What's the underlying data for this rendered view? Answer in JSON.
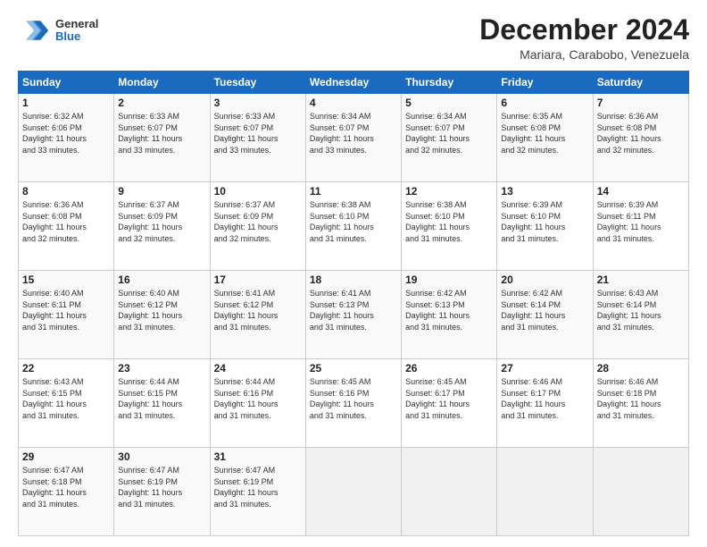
{
  "header": {
    "logo_general": "General",
    "logo_blue": "Blue",
    "month_title": "December 2024",
    "location": "Mariara, Carabobo, Venezuela"
  },
  "days_of_week": [
    "Sunday",
    "Monday",
    "Tuesday",
    "Wednesday",
    "Thursday",
    "Friday",
    "Saturday"
  ],
  "weeks": [
    [
      {
        "day": "1",
        "info": "Sunrise: 6:32 AM\nSunset: 6:06 PM\nDaylight: 11 hours\nand 33 minutes."
      },
      {
        "day": "2",
        "info": "Sunrise: 6:33 AM\nSunset: 6:07 PM\nDaylight: 11 hours\nand 33 minutes."
      },
      {
        "day": "3",
        "info": "Sunrise: 6:33 AM\nSunset: 6:07 PM\nDaylight: 11 hours\nand 33 minutes."
      },
      {
        "day": "4",
        "info": "Sunrise: 6:34 AM\nSunset: 6:07 PM\nDaylight: 11 hours\nand 33 minutes."
      },
      {
        "day": "5",
        "info": "Sunrise: 6:34 AM\nSunset: 6:07 PM\nDaylight: 11 hours\nand 32 minutes."
      },
      {
        "day": "6",
        "info": "Sunrise: 6:35 AM\nSunset: 6:08 PM\nDaylight: 11 hours\nand 32 minutes."
      },
      {
        "day": "7",
        "info": "Sunrise: 6:36 AM\nSunset: 6:08 PM\nDaylight: 11 hours\nand 32 minutes."
      }
    ],
    [
      {
        "day": "8",
        "info": "Sunrise: 6:36 AM\nSunset: 6:08 PM\nDaylight: 11 hours\nand 32 minutes."
      },
      {
        "day": "9",
        "info": "Sunrise: 6:37 AM\nSunset: 6:09 PM\nDaylight: 11 hours\nand 32 minutes."
      },
      {
        "day": "10",
        "info": "Sunrise: 6:37 AM\nSunset: 6:09 PM\nDaylight: 11 hours\nand 32 minutes."
      },
      {
        "day": "11",
        "info": "Sunrise: 6:38 AM\nSunset: 6:10 PM\nDaylight: 11 hours\nand 31 minutes."
      },
      {
        "day": "12",
        "info": "Sunrise: 6:38 AM\nSunset: 6:10 PM\nDaylight: 11 hours\nand 31 minutes."
      },
      {
        "day": "13",
        "info": "Sunrise: 6:39 AM\nSunset: 6:10 PM\nDaylight: 11 hours\nand 31 minutes."
      },
      {
        "day": "14",
        "info": "Sunrise: 6:39 AM\nSunset: 6:11 PM\nDaylight: 11 hours\nand 31 minutes."
      }
    ],
    [
      {
        "day": "15",
        "info": "Sunrise: 6:40 AM\nSunset: 6:11 PM\nDaylight: 11 hours\nand 31 minutes."
      },
      {
        "day": "16",
        "info": "Sunrise: 6:40 AM\nSunset: 6:12 PM\nDaylight: 11 hours\nand 31 minutes."
      },
      {
        "day": "17",
        "info": "Sunrise: 6:41 AM\nSunset: 6:12 PM\nDaylight: 11 hours\nand 31 minutes."
      },
      {
        "day": "18",
        "info": "Sunrise: 6:41 AM\nSunset: 6:13 PM\nDaylight: 11 hours\nand 31 minutes."
      },
      {
        "day": "19",
        "info": "Sunrise: 6:42 AM\nSunset: 6:13 PM\nDaylight: 11 hours\nand 31 minutes."
      },
      {
        "day": "20",
        "info": "Sunrise: 6:42 AM\nSunset: 6:14 PM\nDaylight: 11 hours\nand 31 minutes."
      },
      {
        "day": "21",
        "info": "Sunrise: 6:43 AM\nSunset: 6:14 PM\nDaylight: 11 hours\nand 31 minutes."
      }
    ],
    [
      {
        "day": "22",
        "info": "Sunrise: 6:43 AM\nSunset: 6:15 PM\nDaylight: 11 hours\nand 31 minutes."
      },
      {
        "day": "23",
        "info": "Sunrise: 6:44 AM\nSunset: 6:15 PM\nDaylight: 11 hours\nand 31 minutes."
      },
      {
        "day": "24",
        "info": "Sunrise: 6:44 AM\nSunset: 6:16 PM\nDaylight: 11 hours\nand 31 minutes."
      },
      {
        "day": "25",
        "info": "Sunrise: 6:45 AM\nSunset: 6:16 PM\nDaylight: 11 hours\nand 31 minutes."
      },
      {
        "day": "26",
        "info": "Sunrise: 6:45 AM\nSunset: 6:17 PM\nDaylight: 11 hours\nand 31 minutes."
      },
      {
        "day": "27",
        "info": "Sunrise: 6:46 AM\nSunset: 6:17 PM\nDaylight: 11 hours\nand 31 minutes."
      },
      {
        "day": "28",
        "info": "Sunrise: 6:46 AM\nSunset: 6:18 PM\nDaylight: 11 hours\nand 31 minutes."
      }
    ],
    [
      {
        "day": "29",
        "info": "Sunrise: 6:47 AM\nSunset: 6:18 PM\nDaylight: 11 hours\nand 31 minutes."
      },
      {
        "day": "30",
        "info": "Sunrise: 6:47 AM\nSunset: 6:19 PM\nDaylight: 11 hours\nand 31 minutes."
      },
      {
        "day": "31",
        "info": "Sunrise: 6:47 AM\nSunset: 6:19 PM\nDaylight: 11 hours\nand 31 minutes."
      },
      {
        "day": "",
        "info": ""
      },
      {
        "day": "",
        "info": ""
      },
      {
        "day": "",
        "info": ""
      },
      {
        "day": "",
        "info": ""
      }
    ]
  ]
}
